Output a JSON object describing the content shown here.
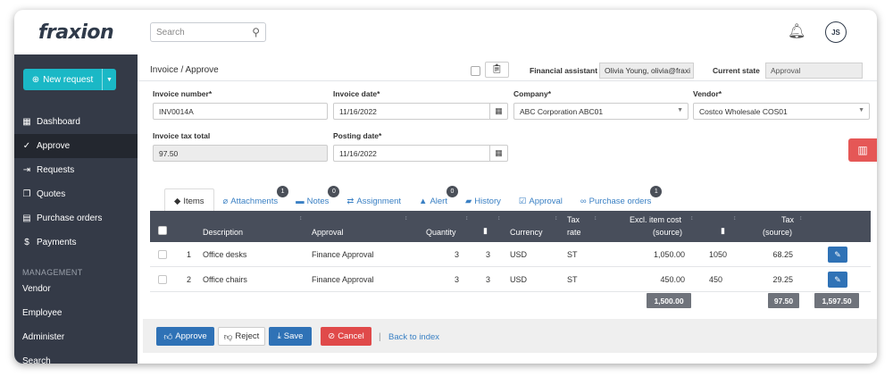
{
  "brand": "fraxion",
  "search": {
    "placeholder": "Search"
  },
  "user_initials": "JS",
  "sidebar": {
    "new_request": "New request",
    "items": [
      {
        "label": "Dashboard",
        "icon": "dashboard-icon"
      },
      {
        "label": "Approve",
        "icon": "check-circle-icon",
        "active": true
      },
      {
        "label": "Requests",
        "icon": "request-icon"
      },
      {
        "label": "Quotes",
        "icon": "file-icon"
      },
      {
        "label": "Purchase orders",
        "icon": "document-icon"
      },
      {
        "label": "Payments",
        "icon": "dollar-icon"
      }
    ],
    "section": "MANAGEMENT",
    "management": [
      "Vendor",
      "Employee",
      "Administer",
      "Search"
    ]
  },
  "breadcrumb": "Invoice / Approve",
  "financial_assistant": {
    "label": "Financial assistant",
    "value": "Olivia Young, olivia@fraxi"
  },
  "current_state": {
    "label": "Current state",
    "value": "Approval"
  },
  "form": {
    "invoice_number": {
      "label": "Invoice number*",
      "value": "INV0014A"
    },
    "invoice_date": {
      "label": "Invoice date*",
      "value": "11/16/2022"
    },
    "company": {
      "label": "Company*",
      "value": "ABC Corporation ABC01"
    },
    "vendor": {
      "label": "Vendor*",
      "value": "Costco Wholesale COS01"
    },
    "invoice_tax_total": {
      "label": "Invoice tax total",
      "value": "97.50"
    },
    "posting_date": {
      "label": "Posting date*",
      "value": "11/16/2022"
    }
  },
  "tabs": [
    {
      "label": "Items",
      "icon": "tag-icon",
      "active": true,
      "badge": ""
    },
    {
      "label": "Attachments",
      "icon": "paperclip-icon",
      "badge": "1"
    },
    {
      "label": "Notes",
      "icon": "comment-icon",
      "badge": "0"
    },
    {
      "label": "Assignment",
      "icon": "exchange-icon",
      "badge": ""
    },
    {
      "label": "Alert",
      "icon": "warning-icon",
      "badge": "0"
    },
    {
      "label": "History",
      "icon": "folder-icon",
      "badge": ""
    },
    {
      "label": "Approval",
      "icon": "check-square-icon",
      "badge": ""
    },
    {
      "label": "Purchase orders",
      "icon": "link-icon",
      "badge": "1"
    }
  ],
  "table": {
    "headers": {
      "description": "Description",
      "approval": "Approval",
      "quantity": "Quantity",
      "currency": "Currency",
      "tax_rate_1": "Tax",
      "tax_rate_2": "rate",
      "excl_1": "Excl. item cost",
      "excl_2": "(source)",
      "tax_1": "Tax",
      "tax_2": "(source)"
    },
    "rows": [
      {
        "num": "1",
        "description": "Office desks",
        "approval": "Finance Approval",
        "quantity": "3",
        "qty2": "3",
        "currency": "USD",
        "tax_rate": "ST",
        "excl": "1,050.00",
        "excl2": "1050",
        "tax": "68.25"
      },
      {
        "num": "2",
        "description": "Office chairs",
        "approval": "Finance Approval",
        "quantity": "3",
        "qty2": "3",
        "currency": "USD",
        "tax_rate": "ST",
        "excl": "450.00",
        "excl2": "450",
        "tax": "29.25"
      }
    ],
    "totals": {
      "excl": "1,500.00",
      "tax": "97.50",
      "grand": "1,597.50"
    }
  },
  "footer": {
    "approve": "Approve",
    "reject": "Reject",
    "save": "Save",
    "cancel": "Cancel",
    "separator": "|",
    "back": "Back to index"
  },
  "colors": {
    "accent": "#1ab8c6",
    "primary": "#2f72b6",
    "danger": "#e04a4a",
    "sidebar": "#343a47"
  }
}
